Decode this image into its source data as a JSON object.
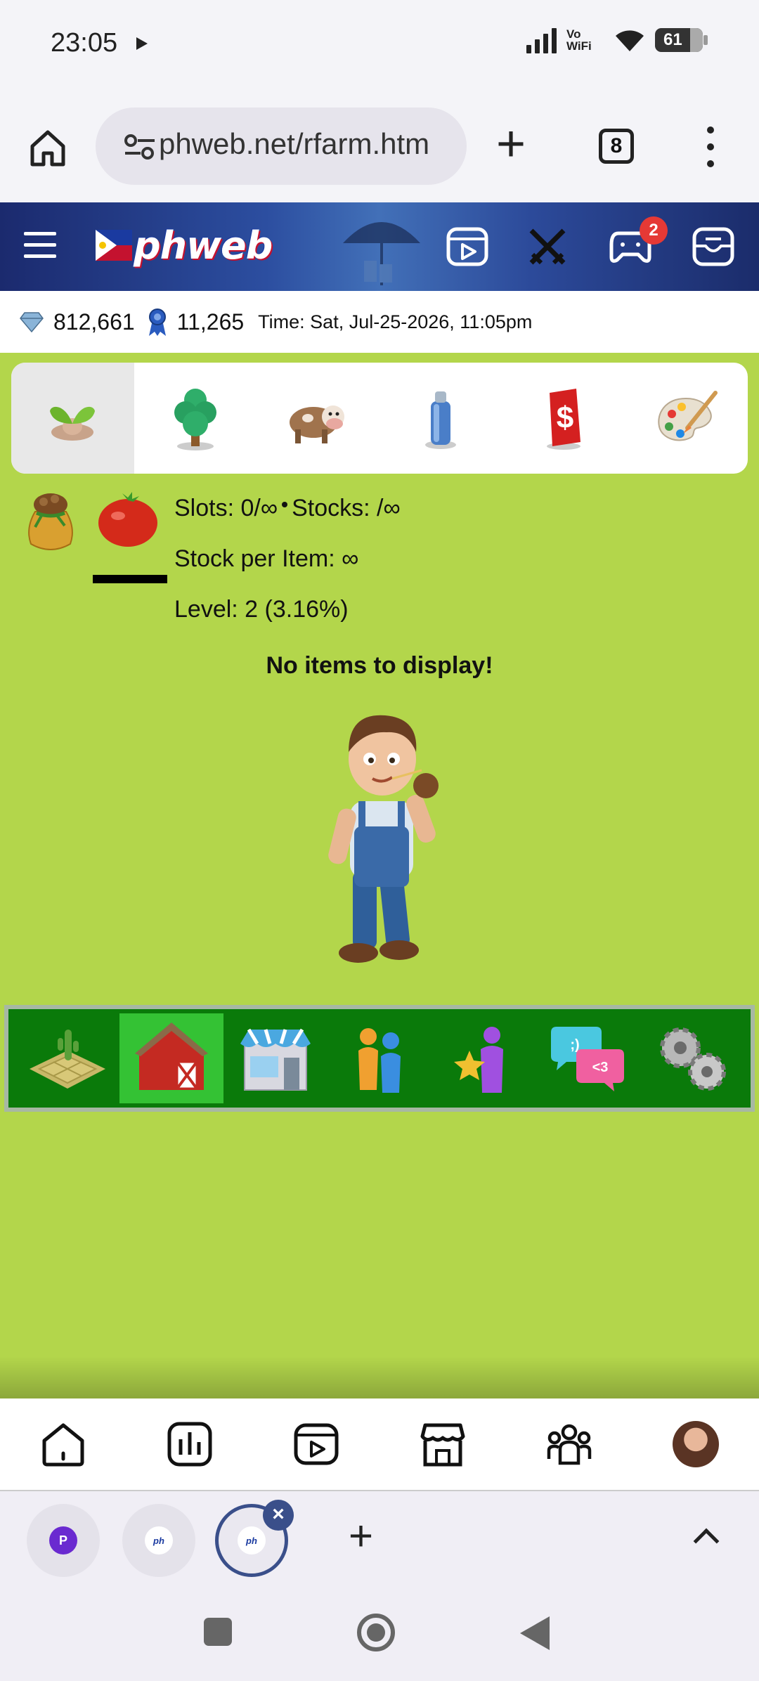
{
  "status_bar": {
    "time": "23:05",
    "network_label_top": "Vo",
    "network_label_bottom": "WiFi",
    "battery": "61"
  },
  "browser": {
    "url": "phweb.net/rfarm.htm",
    "tab_count": "8"
  },
  "site_header": {
    "logo_text": "phweb",
    "notification_count": "2"
  },
  "info_bar": {
    "diamonds": "812,661",
    "medals": "11,265",
    "time_label": "Time: Sat, Jul-25-2026, 11:05pm"
  },
  "category_tabs": [
    {
      "name": "seeds-tab",
      "icon": "sprout-icon",
      "active": true
    },
    {
      "name": "trees-tab",
      "icon": "tree-icon",
      "active": false
    },
    {
      "name": "animals-tab",
      "icon": "cow-icon",
      "active": false
    },
    {
      "name": "supplies-tab",
      "icon": "spray-can-icon",
      "active": false
    },
    {
      "name": "cash-tab",
      "icon": "dollar-card-icon",
      "active": false
    },
    {
      "name": "decor-tab",
      "icon": "palette-icon",
      "active": false
    }
  ],
  "storage": {
    "slots": "Slots: 0/∞",
    "stocks": "Stocks: /∞",
    "stock_per_item": "Stock per Item: ∞",
    "level": "Level: 2 (3.16%)",
    "empty_message": "No items to display!"
  },
  "bottom_menu": [
    {
      "name": "farm-plot",
      "icon": "farm-plot-icon",
      "active": false
    },
    {
      "name": "barn",
      "icon": "barn-icon",
      "active": true
    },
    {
      "name": "market-shop",
      "icon": "shop-icon",
      "active": false
    },
    {
      "name": "neighbors",
      "icon": "people-icon",
      "active": false
    },
    {
      "name": "favorites",
      "icon": "star-person-icon",
      "active": false
    },
    {
      "name": "chat",
      "icon": "chat-bubbles-icon",
      "active": false
    },
    {
      "name": "settings",
      "icon": "gears-icon",
      "active": false
    }
  ],
  "colors": {
    "grass": "#b3d64b",
    "menu_green": "#0a7a0a",
    "menu_active": "#34c234",
    "header_blue": "#2c4ea0",
    "badge_red": "#e53935"
  }
}
